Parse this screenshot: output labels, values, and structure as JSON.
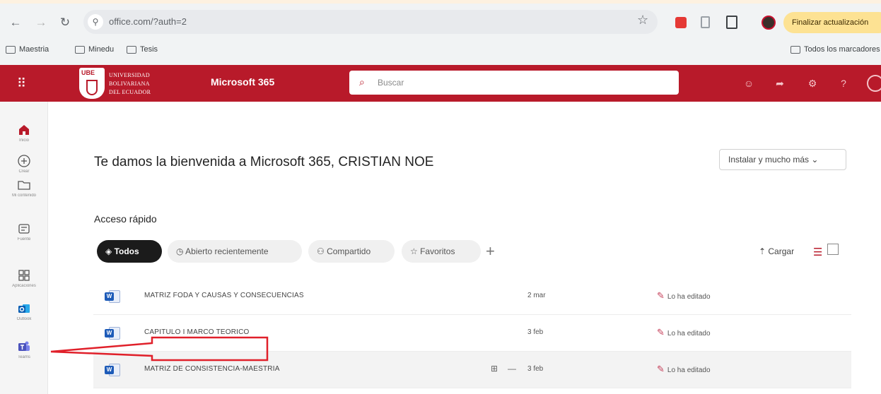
{
  "browser": {
    "url": "office.com/?auth=2",
    "update_button": "Finalizar actualización",
    "bookmarks": [
      "Maestria",
      "Minedu",
      "Tesis"
    ],
    "bookmarks_right": "Todos los marcadores"
  },
  "header": {
    "university": [
      "UNIVERSIDAD",
      "BOLIVARIANA",
      "DEL ECUADOR"
    ],
    "crest_tag": "UBE",
    "app_name": "Microsoft 365",
    "search_placeholder": "Buscar"
  },
  "rail": [
    {
      "name": "home",
      "label": "Inicio",
      "icon": "home-icon"
    },
    {
      "name": "create",
      "label": "Crear",
      "icon": "plus-circle-icon"
    },
    {
      "name": "my-content",
      "label": "Mi contenido",
      "icon": "folder-icon"
    },
    {
      "name": "feed",
      "label": "Fuente",
      "icon": "feed-icon"
    },
    {
      "name": "apps",
      "label": "Aplicaciones",
      "icon": "apps-icon"
    },
    {
      "name": "outlook",
      "label": "Outlook",
      "icon": "outlook-icon"
    },
    {
      "name": "teams",
      "label": "Teams",
      "icon": "teams-icon"
    }
  ],
  "main": {
    "welcome": "Te damos la bienvenida a Microsoft 365, CRISTIAN NOE",
    "install_button": "Instalar y mucho más",
    "quick_access": "Acceso rápido",
    "filters": [
      "Todos",
      "Abierto recientemente",
      "Compartido",
      "Favoritos"
    ],
    "upload": "Cargar"
  },
  "files": [
    {
      "name": "MATRIZ FODA Y CAUSAS Y CONSECUENCIAS",
      "date": "2 mar",
      "activity": "Lo ha editado"
    },
    {
      "name": "CAPITULO I MARCO TEORICO",
      "date": "3 feb",
      "activity": "Lo ha editado"
    },
    {
      "name": "MATRIZ DE CONSISTENCIA-MAESTRIA",
      "date": "3 feb",
      "activity": "Lo ha editado"
    }
  ],
  "colors": {
    "brand": "#b81a2a",
    "annotation": "#e0202a",
    "word": "#1d5bb8"
  }
}
